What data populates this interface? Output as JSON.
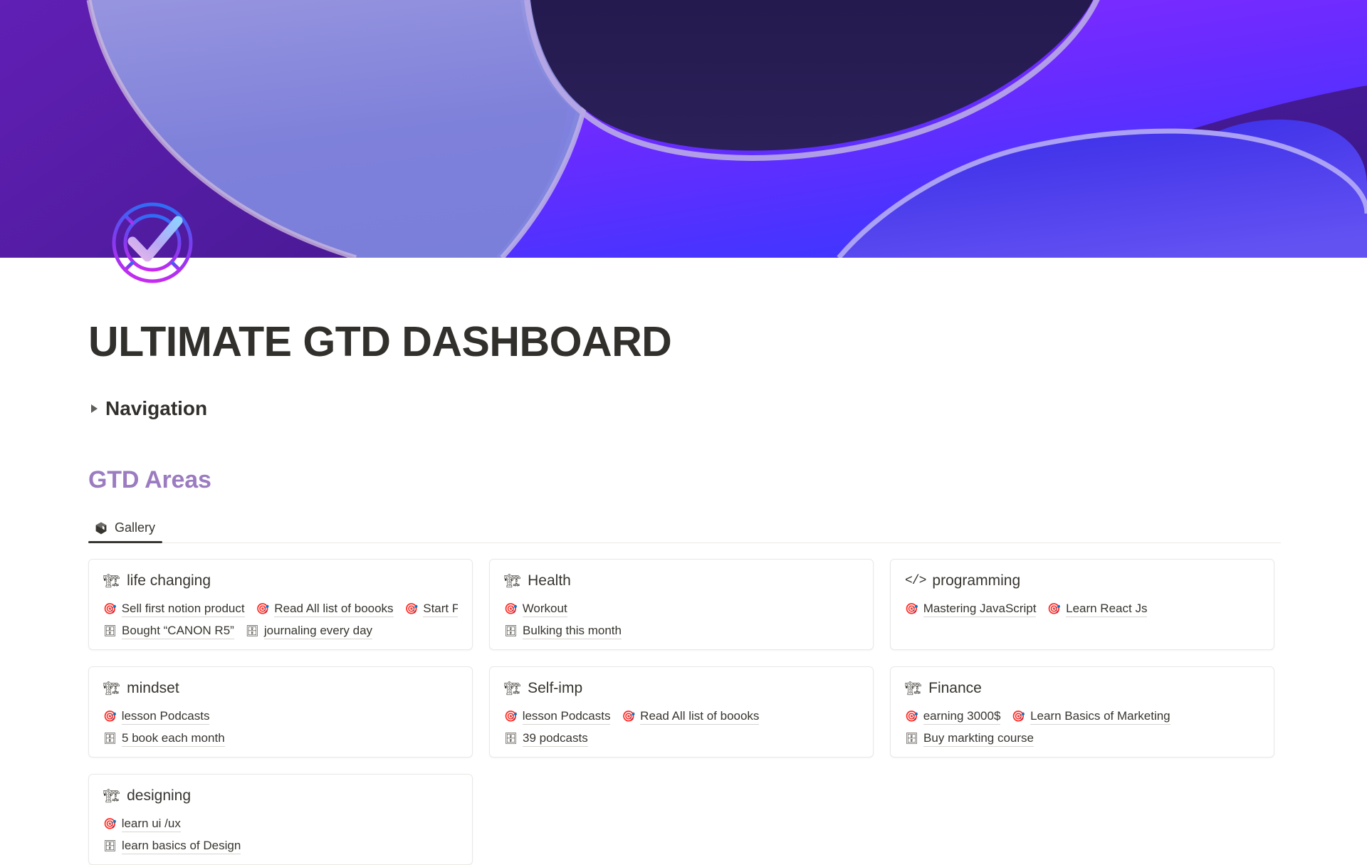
{
  "header": {
    "title": "ULTIMATE GTD DASHBOARD",
    "icon_name": "gtd-check-dial-icon",
    "cover_name": "purple-abstract-waves-cover"
  },
  "navigation": {
    "label": "Navigation",
    "collapsed": true,
    "caret_icon": "triangle-right-icon"
  },
  "areas_section": {
    "title": "GTD Areas",
    "accent_color": "#9b7cc0",
    "view_tabs": [
      {
        "label": "Gallery",
        "icon": "gallery-box-icon",
        "active": true
      }
    ]
  },
  "gallery": {
    "cards": [
      {
        "icon": "crane-icon",
        "icon_glyph": "🏗",
        "title": "life changing",
        "goals": [
          {
            "icon": "dart-icon",
            "icon_glyph": "🎯",
            "label": "Sell first notion product"
          },
          {
            "icon": "dart-icon",
            "icon_glyph": "🎯",
            "label": "Read All list of boooks"
          },
          {
            "icon": "dart-icon",
            "icon_glyph": "🎯",
            "label": "Start Phtotgraphy"
          }
        ],
        "items": [
          {
            "icon": "file-cabinet-icon",
            "icon_glyph": "🗄",
            "label": "Bought “CANON R5”"
          },
          {
            "icon": "file-cabinet-icon",
            "icon_glyph": "🗄",
            "label": "journaling every day"
          }
        ]
      },
      {
        "icon": "crane-icon",
        "icon_glyph": "🏗",
        "title": "Health",
        "goals": [
          {
            "icon": "dart-icon",
            "icon_glyph": "🎯",
            "label": "Workout"
          }
        ],
        "items": [
          {
            "icon": "file-cabinet-icon",
            "icon_glyph": "🗄",
            "label": "Bulking this month"
          }
        ]
      },
      {
        "icon": "code-icon",
        "icon_glyph": "</>",
        "title": "programming",
        "goals": [
          {
            "icon": "dart-icon",
            "icon_glyph": "🎯",
            "label": "Mastering JavaScript"
          },
          {
            "icon": "dart-icon",
            "icon_glyph": "🎯",
            "label": "Learn React Js"
          }
        ],
        "items": []
      },
      {
        "icon": "crane-icon",
        "icon_glyph": "🏗",
        "title": "mindset",
        "goals": [
          {
            "icon": "dart-icon",
            "icon_glyph": "🎯",
            "label": "lesson Podcasts"
          }
        ],
        "items": [
          {
            "icon": "file-cabinet-icon",
            "icon_glyph": "🗄",
            "label": "5 book each month"
          }
        ]
      },
      {
        "icon": "crane-icon",
        "icon_glyph": "🏗",
        "title": "Self-imp",
        "goals": [
          {
            "icon": "dart-icon",
            "icon_glyph": "🎯",
            "label": "lesson Podcasts"
          },
          {
            "icon": "dart-icon",
            "icon_glyph": "🎯",
            "label": "Read All list of boooks"
          }
        ],
        "items": [
          {
            "icon": "file-cabinet-icon",
            "icon_glyph": "🗄",
            "label": "39 podcasts"
          }
        ]
      },
      {
        "icon": "crane-icon",
        "icon_glyph": "🏗",
        "title": "Finance",
        "goals": [
          {
            "icon": "dart-icon",
            "icon_glyph": "🎯",
            "label": "earning 3000$"
          },
          {
            "icon": "dart-icon",
            "icon_glyph": "🎯",
            "label": "Learn Basics of Marketing"
          }
        ],
        "items": [
          {
            "icon": "file-cabinet-icon",
            "icon_glyph": "🗄",
            "label": "Buy markting course"
          }
        ]
      },
      {
        "icon": "crane-icon",
        "icon_glyph": "🏗",
        "title": "designing",
        "goals": [
          {
            "icon": "dart-icon",
            "icon_glyph": "🎯",
            "label": "learn ui /ux"
          }
        ],
        "items": [
          {
            "icon": "file-cabinet-icon",
            "icon_glyph": "🗄",
            "label": "learn basics of Design"
          }
        ]
      }
    ]
  }
}
